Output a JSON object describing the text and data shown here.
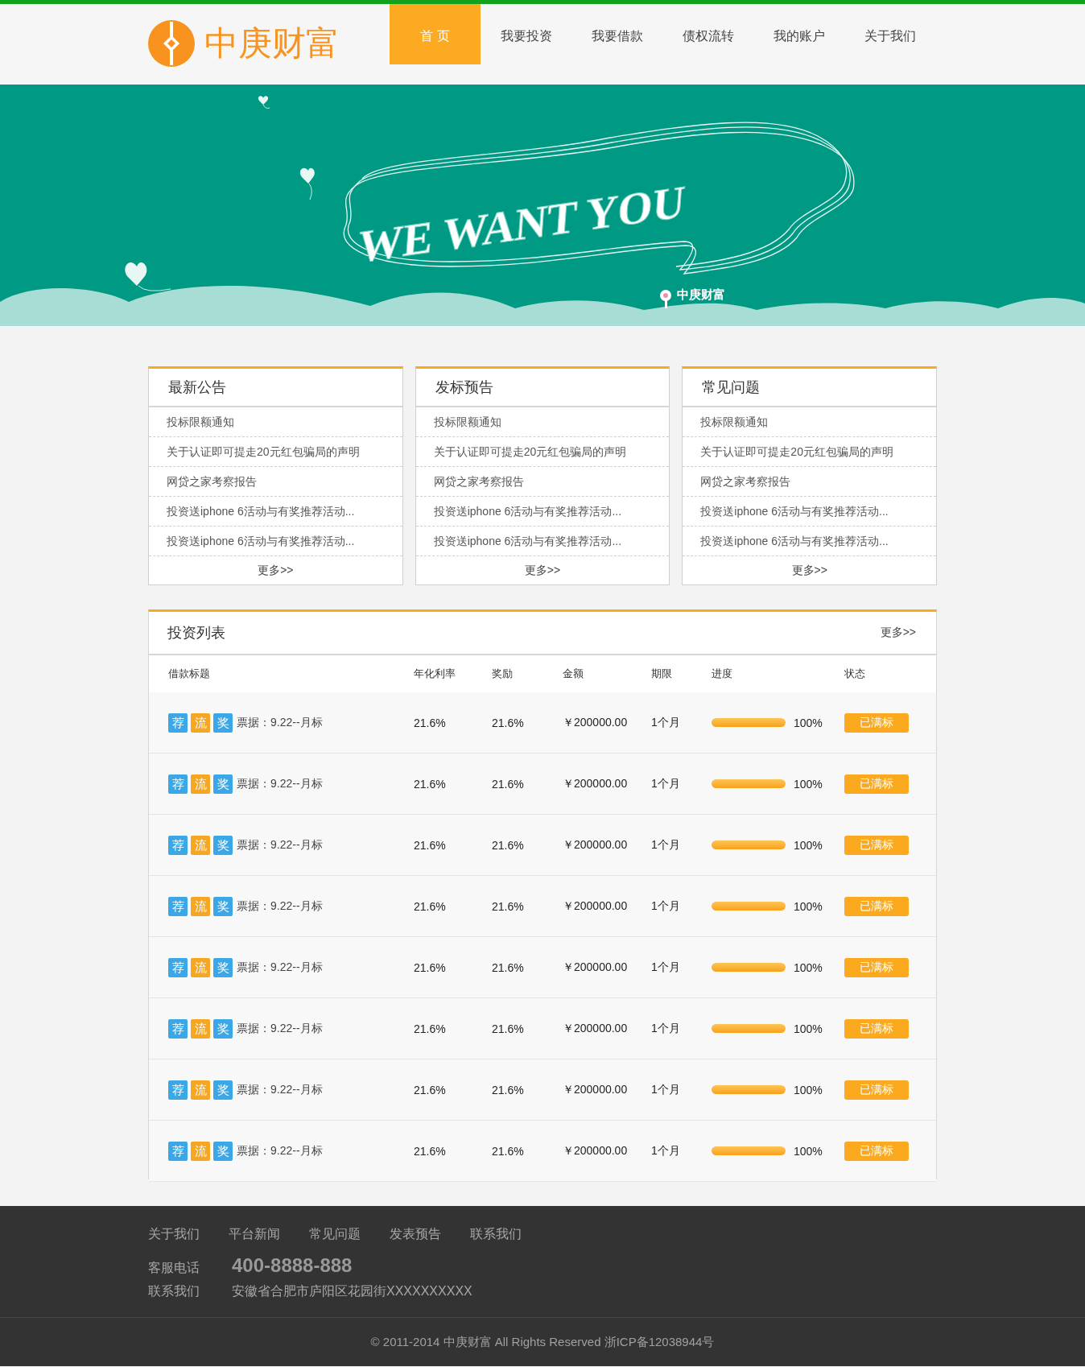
{
  "header": {
    "brand": "中庚财富",
    "nav": [
      {
        "label": "首 页",
        "selected": true
      },
      {
        "label": "我要投资",
        "selected": false
      },
      {
        "label": "我要借款",
        "selected": false
      },
      {
        "label": "债权流转",
        "selected": false
      },
      {
        "label": "我的账户",
        "selected": false
      },
      {
        "label": "关于我们",
        "selected": false
      }
    ]
  },
  "banner": {
    "slogan": "WE WANT YOU",
    "caption": "中庚财富"
  },
  "cards": [
    {
      "title": "最新公告",
      "items": [
        "投标限额通知",
        "关于认证即可提走20元红包骗局的声明",
        "网贷之家考察报告",
        "投资送iphone 6活动与有奖推荐活动...",
        "投资送iphone 6活动与有奖推荐活动..."
      ],
      "more": "更多>>"
    },
    {
      "title": "发标预告",
      "items": [
        "投标限额通知",
        "关于认证即可提走20元红包骗局的声明",
        "网贷之家考察报告",
        "投资送iphone 6活动与有奖推荐活动...",
        "投资送iphone 6活动与有奖推荐活动..."
      ],
      "more": "更多>>"
    },
    {
      "title": "常见问题",
      "items": [
        "投标限额通知",
        "关于认证即可提走20元红包骗局的声明",
        "网贷之家考察报告",
        "投资送iphone 6活动与有奖推荐活动...",
        "投资送iphone 6活动与有奖推荐活动..."
      ],
      "more": "更多>>"
    }
  ],
  "table": {
    "title": "投资列表",
    "more": "更多>>",
    "columns": [
      "借款标题",
      "年化利率",
      "奖励",
      "金额",
      "期限",
      "进度",
      "状态"
    ],
    "rows": [
      {
        "tags": [
          {
            "text": "荐",
            "color": "#3ba7e6"
          },
          {
            "text": "流",
            "color": "#f5a623"
          },
          {
            "text": "奖",
            "color": "#3ba7e6"
          }
        ],
        "title": "票据：9.22--月标",
        "rate": "21.6%",
        "reward": "21.6%",
        "amount": "￥200000.00",
        "term": "1个月",
        "level": 1,
        "progress": "100%",
        "status": "已满标"
      },
      {
        "tags": [
          {
            "text": "荐",
            "color": "#3ba7e6"
          },
          {
            "text": "流",
            "color": "#f5a623"
          },
          {
            "text": "奖",
            "color": "#3ba7e6"
          }
        ],
        "title": "票据：9.22--月标",
        "rate": "21.6%",
        "reward": "21.6%",
        "amount": "￥200000.00",
        "term": "1个月",
        "level": 1,
        "progress": "100%",
        "status": "已满标"
      },
      {
        "tags": [
          {
            "text": "荐",
            "color": "#3ba7e6"
          },
          {
            "text": "流",
            "color": "#f5a623"
          },
          {
            "text": "奖",
            "color": "#3ba7e6"
          }
        ],
        "title": "票据：9.22--月标",
        "rate": "21.6%",
        "reward": "21.6%",
        "amount": "￥200000.00",
        "term": "1个月",
        "level": 1,
        "progress": "100%",
        "status": "已满标"
      },
      {
        "tags": [
          {
            "text": "荐",
            "color": "#3ba7e6"
          },
          {
            "text": "流",
            "color": "#f5a623"
          },
          {
            "text": "奖",
            "color": "#3ba7e6"
          }
        ],
        "title": "票据：9.22--月标",
        "rate": "21.6%",
        "reward": "21.6%",
        "amount": "￥200000.00",
        "term": "1个月",
        "level": 1,
        "progress": "100%",
        "status": "已满标"
      },
      {
        "tags": [
          {
            "text": "荐",
            "color": "#3ba7e6"
          },
          {
            "text": "流",
            "color": "#f5a623"
          },
          {
            "text": "奖",
            "color": "#3ba7e6"
          }
        ],
        "title": "票据：9.22--月标",
        "rate": "21.6%",
        "reward": "21.6%",
        "amount": "￥200000.00",
        "term": "1个月",
        "level": 1,
        "progress": "100%",
        "status": "已满标"
      },
      {
        "tags": [
          {
            "text": "荐",
            "color": "#3ba7e6"
          },
          {
            "text": "流",
            "color": "#f5a623"
          },
          {
            "text": "奖",
            "color": "#3ba7e6"
          }
        ],
        "title": "票据：9.22--月标",
        "rate": "21.6%",
        "reward": "21.6%",
        "amount": "￥200000.00",
        "term": "1个月",
        "level": 1,
        "progress": "100%",
        "status": "已满标"
      },
      {
        "tags": [
          {
            "text": "荐",
            "color": "#3ba7e6"
          },
          {
            "text": "流",
            "color": "#f5a623"
          },
          {
            "text": "奖",
            "color": "#3ba7e6"
          }
        ],
        "title": "票据：9.22--月标",
        "rate": "21.6%",
        "reward": "21.6%",
        "amount": "￥200000.00",
        "term": "1个月",
        "level": 1,
        "progress": "100%",
        "status": "已满标"
      },
      {
        "tags": [
          {
            "text": "荐",
            "color": "#3ba7e6"
          },
          {
            "text": "流",
            "color": "#f5a623"
          },
          {
            "text": "奖",
            "color": "#3ba7e6"
          }
        ],
        "title": "票据：9.22--月标",
        "rate": "21.6%",
        "reward": "21.6%",
        "amount": "￥200000.00",
        "term": "1个月",
        "level": 1,
        "progress": "100%",
        "status": "已满标"
      }
    ]
  },
  "footer": {
    "links": [
      "关于我们",
      "平台新闻",
      "常见问题",
      "发表预告",
      "联系我们"
    ],
    "phone_label": "客服电话",
    "phone": "400-8888-888",
    "address_label": "联系我们",
    "address": "安徽省合肥市庐阳区花园街XXXXXXXXXX",
    "copyright": "© 2011-2014 中庚财富 All Rights Reserved 浙ICP备12038944号"
  }
}
